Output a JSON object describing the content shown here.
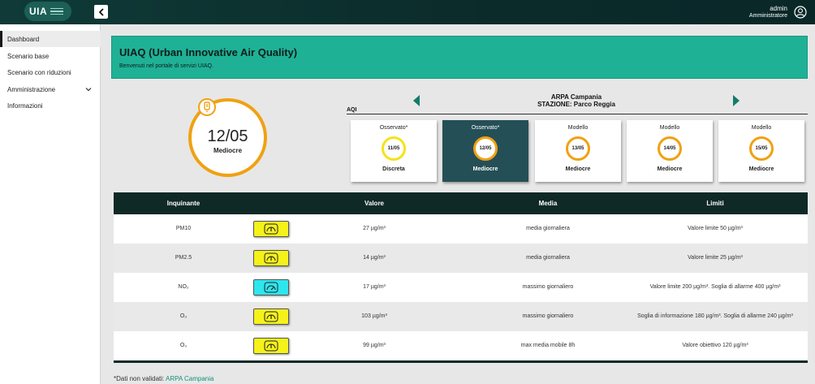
{
  "app": {
    "logo_text": "UIA",
    "user_name": "admin",
    "user_role": "Amministratore"
  },
  "sidebar": {
    "items": [
      {
        "label": "Dashboard"
      },
      {
        "label": "Scenario base"
      },
      {
        "label": "Scenario con riduzioni"
      },
      {
        "label": "Amministrazione"
      },
      {
        "label": "Informazioni"
      }
    ]
  },
  "banner": {
    "title": "UIAQ (Urban Innovative Air Quality)",
    "subtitle": "Benvenuti nel portale di servizi UIAQ."
  },
  "current": {
    "date": "12/05",
    "quality": "Mediocre",
    "color": "#f0a112"
  },
  "station": {
    "agency": "ARPA Campania",
    "name": "STAZIONE: Parco Reggia",
    "aqi_label": "AQI"
  },
  "days": [
    {
      "type": "Osservato*",
      "date": "11/05",
      "quality": "Discreta",
      "color": "yellow"
    },
    {
      "type": "Osservato*",
      "date": "12/05",
      "quality": "Mediocre",
      "color": "orange"
    },
    {
      "type": "Modello",
      "date": "13/05",
      "quality": "Mediocre",
      "color": "orange"
    },
    {
      "type": "Modello",
      "date": "14/05",
      "quality": "Mediocre",
      "color": "orange"
    },
    {
      "type": "Modello",
      "date": "15/05",
      "quality": "Mediocre",
      "color": "orange"
    }
  ],
  "table": {
    "headers": {
      "pollutant": "Inquinante",
      "value": "Valore",
      "mean": "Media",
      "limits": "Limiti"
    },
    "rows": [
      {
        "pollutant": "PM10",
        "value": "27 µg/m³",
        "mean": "media giornaliera",
        "limit": "Valore limite 50 µg/m³",
        "badge_color": "#f5f21a"
      },
      {
        "pollutant": "PM2.5",
        "value": "14 µg/m³",
        "mean": "media giornaliera",
        "limit": "Valore limite 25 µg/m³",
        "badge_color": "#f5f21a"
      },
      {
        "pollutant": "NO₂",
        "value": "17 µg/m³",
        "mean": "massimo giornaliero",
        "limit": "Valore limite 200 µg/m³. Soglia di allarme 400 µg/m³",
        "badge_color": "#2ee6ee"
      },
      {
        "pollutant": "O₃",
        "value": "103 µg/m³",
        "mean": "massimo giornaliero",
        "limit": "Soglia di informazione 180 µg/m³. Soglia di allarme 240 µg/m³",
        "badge_color": "#f5f21a"
      },
      {
        "pollutant": "O₃",
        "value": "99 µg/m³",
        "mean": "max media mobile 8h",
        "limit": "Valore obiettivo 120 µg/m³",
        "badge_color": "#f5f21a"
      }
    ]
  },
  "footnote": {
    "text": "*Dati non validati: ",
    "link": "ARPA Campania"
  }
}
